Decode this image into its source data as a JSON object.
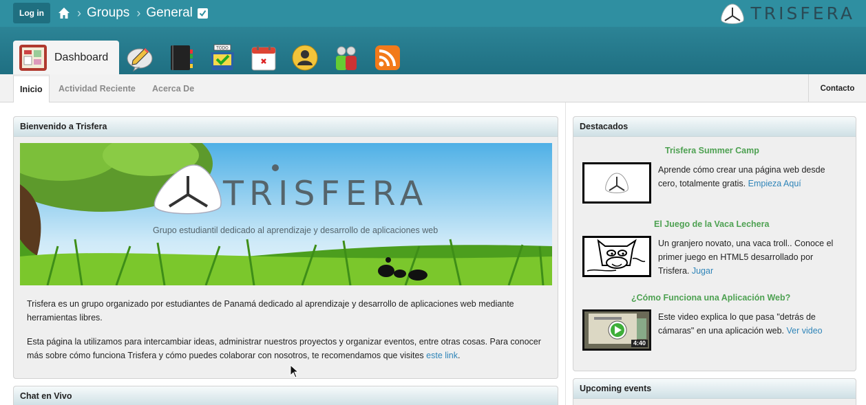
{
  "topbar": {
    "login_label": "Log in",
    "breadcrumbs": [
      "Groups",
      "General"
    ],
    "brand": "TRISFERA"
  },
  "apps": {
    "active_label": "Dashboard",
    "icons": [
      "dashboard-icon",
      "pencil-chat-icon",
      "notebook-icon",
      "todo-icon",
      "calendar-icon",
      "user-icon",
      "people-icon",
      "rss-icon"
    ]
  },
  "subnav": {
    "tabs": [
      "Inicio",
      "Actividad Reciente",
      "Acerca De"
    ],
    "contact": "Contacto"
  },
  "welcome": {
    "title": "Bienvenido a Trisfera",
    "banner_brand": "TRISFERA",
    "banner_tagline": "Grupo estudiantil dedicado al aprendizaje y desarrollo de aplicaciones web",
    "para1": "Trisfera es un grupo organizado por estudiantes de Panamá dedicado al aprendizaje y desarrollo de aplicaciones web mediante herramientas libres.",
    "para2": "Esta página la utilizamos para intercambiar ideas, administrar nuestros proyectos y organizar eventos, entre otras cosas. Para conocer más sobre cómo funciona Trisfera y cómo puedes colaborar con nosotros, te recomendamos que visites ",
    "para2_link": "este link",
    "para2_end": "."
  },
  "chat": {
    "title": "Chat en Vivo"
  },
  "featured": {
    "title": "Destacados",
    "items": [
      {
        "title": "Trisfera Summer Camp",
        "text": "Aprende cómo crear una página web desde cero, totalmente gratis. ",
        "link": "Empieza Aquí"
      },
      {
        "title": "El Juego de la Vaca Lechera",
        "text": "Un granjero novato, una vaca troll.. Conoce el primer juego en HTML5 desarrollado por Trisfera. ",
        "link": "Jugar"
      },
      {
        "title": "¿Cómo Funciona una Aplicación Web?",
        "text": "Este video explica lo que pasa \"detrás de cámaras\" en una aplicación web. ",
        "link": "Ver video",
        "duration": "4:40"
      }
    ]
  },
  "events": {
    "title": "Upcoming events"
  }
}
